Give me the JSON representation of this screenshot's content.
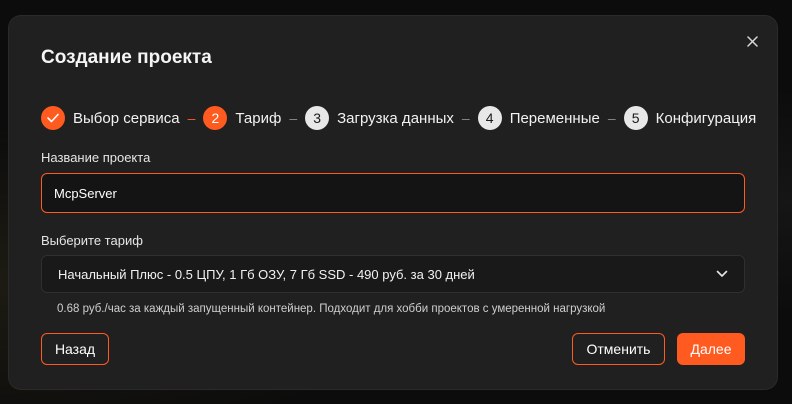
{
  "dialog": {
    "title": "Создание проекта"
  },
  "stepper": {
    "steps": [
      {
        "number": "✓",
        "label": "Выбор сервиса",
        "state": "done"
      },
      {
        "number": "2",
        "label": "Тариф",
        "state": "active"
      },
      {
        "number": "3",
        "label": "Загрузка данных",
        "state": "pending"
      },
      {
        "number": "4",
        "label": "Переменные",
        "state": "pending"
      },
      {
        "number": "5",
        "label": "Конфигурация",
        "state": "pending"
      }
    ],
    "separator": "–"
  },
  "form": {
    "project_name_label": "Название проекта",
    "project_name_value": "McpServer",
    "tariff_label": "Выберите тариф",
    "tariff_selected": "Начальный Плюс - 0.5 ЦПУ, 1 Гб ОЗУ, 7 Гб SSD - 490 руб. за 30 дней",
    "tariff_hint": "0.68 руб./час за каждый запущенный контейнер. Подходит для хобби проектов с умеренной нагрузкой"
  },
  "actions": {
    "back_label": "Назад",
    "cancel_label": "Отменить",
    "next_label": "Далее"
  },
  "colors": {
    "accent": "#ff5a1f",
    "modal_bg": "#202020"
  }
}
